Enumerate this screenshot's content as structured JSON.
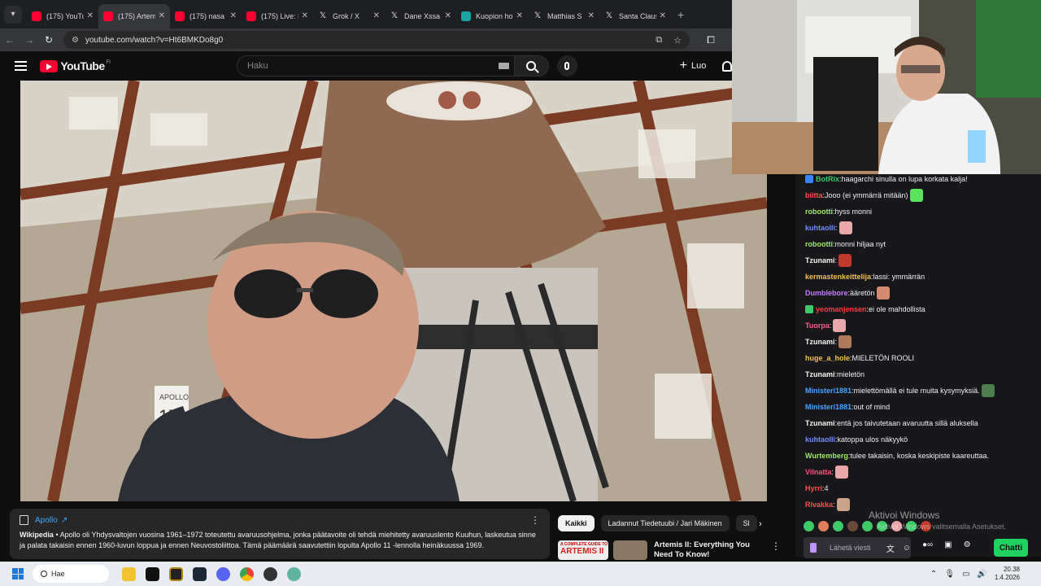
{
  "browser": {
    "tabs": [
      {
        "title": "(175) YouTu",
        "icon": "youtube-icon",
        "active": false
      },
      {
        "title": "(175) Artem",
        "icon": "youtube-icon",
        "active": true
      },
      {
        "title": "(175) nasa l",
        "icon": "youtube-icon",
        "active": false
      },
      {
        "title": "(175) Live: I",
        "icon": "youtube-icon",
        "active": false
      },
      {
        "title": "Grok / X",
        "icon": "x-icon",
        "active": false
      },
      {
        "title": "Dane Xssa",
        "icon": "x-icon",
        "active": false
      },
      {
        "title": "Kuopion ho",
        "icon": "kuopio-icon",
        "active": false
      },
      {
        "title": "Matthias S",
        "icon": "x-icon",
        "active": false
      },
      {
        "title": "Santa Claus",
        "icon": "x-icon",
        "active": false
      }
    ],
    "url": "youtube.com/watch?v=Ht6BMKDo8g0"
  },
  "youtube": {
    "logo_text": "YouTube",
    "region": "FI",
    "search_placeholder": "Haku",
    "create_label": "Luo"
  },
  "wiki_panel": {
    "title": "Apollo",
    "source": "Wikipedia",
    "text": "Apollo oli Yhdysvaltojen vuosina 1961–1972 toteutettu avaruusohjelma, jonka päätavoite oli tehdä miehitetty avaruuslento Kuuhun, laskeutua sinne ja palata takaisin ennen 1960-luvun loppua ja ennen Neuvostoliittoa. Tämä päämäärä saavutettiin lopulta Apollo 11 -lennolla heinäkuussa 1969."
  },
  "chips": [
    "Kaikki",
    "Ladannut Tiedetuubi / Jari Mäkinen",
    "Sl"
  ],
  "related": {
    "thumb_small": "A COMPLETE GUIDE TO",
    "thumb_big": "ARTEMIS II",
    "title": "Artemis II: Everything You Need To Know!"
  },
  "video": {
    "sign_text": "APOLLO",
    "sign_number": "17"
  },
  "chat": {
    "messages": [
      {
        "user": "BotRix",
        "color": "#3ec96a",
        "text": "haagarchi sinulla on lupa korkata kalja!",
        "badge": "#3b82f6"
      },
      {
        "user": "biitta",
        "color": "#ff4f4f",
        "text": "Jooo (ei ymmärrä mitään)",
        "emote": "#5be35b"
      },
      {
        "user": "robootti",
        "color": "#9ee86c",
        "text": "hyss monni"
      },
      {
        "user": "kuhtaolli",
        "color": "#6f8cff",
        "text": "",
        "emote": "#e9a8a8"
      },
      {
        "user": "robootti",
        "color": "#9ee86c",
        "text": "monni hiljaa nyt"
      },
      {
        "user": "Tzunami",
        "color": "#f1f1f1",
        "text": "",
        "emote": "#c0392b"
      },
      {
        "user": "kermastenkeittelija",
        "color": "#f2c14e",
        "text": "lassi: ymmärrän"
      },
      {
        "user": "Dumblebore",
        "color": "#c77dff",
        "text": "ääretön",
        "emote": "#d68a6f"
      },
      {
        "user": "yeomanjensen",
        "color": "#ff3b3b",
        "text": "ei ole mahdollista",
        "badge": "#3ec96a"
      },
      {
        "user": "Tuorpa",
        "color": "#ff5a8a",
        "text": "",
        "emote": "#e9a8a8"
      },
      {
        "user": "Tzunami",
        "color": "#f1f1f1",
        "text": "",
        "emote": "#b07a5a"
      },
      {
        "user": "huge_a_hole",
        "color": "#f2c14e",
        "text": "MIELETÖN ROOLI"
      },
      {
        "user": "Tzunami",
        "color": "#f1f1f1",
        "text": "mieletön"
      },
      {
        "user": "Ministeri1881",
        "color": "#4aa3ff",
        "text": "mielettömällä ei tule muita kysymyksiä.",
        "emote": "#4f7d4f"
      },
      {
        "user": "Ministeri1881",
        "color": "#4aa3ff",
        "text": "out of mind"
      },
      {
        "user": "Tzunami",
        "color": "#f1f1f1",
        "text": "entä jos taivutetaan avaruutta sillä aluksella"
      },
      {
        "user": "kuhtaolli",
        "color": "#6f8cff",
        "text": "katoppa ulos näkyykö"
      },
      {
        "user": "Wurtemberg",
        "color": "#9ee86c",
        "text": "tulee takaisin, koska keskipiste kaareuttaa."
      },
      {
        "user": "Vilnatta",
        "color": "#ff4f7b",
        "text": "",
        "emote": "#e9a8a8"
      },
      {
        "user": "Hyrri",
        "color": "#ff4f4f",
        "text": "4"
      },
      {
        "user": "Rivakka",
        "color": "#ff4f4f",
        "text": "",
        "emote": "#c9a48a"
      }
    ],
    "input_placeholder": "Lähetä viesti",
    "send_label": "Chatti"
  },
  "watermark": {
    "line1": "Aktivoi Windows",
    "line2": "Aktivoi Windows valitsemalla Asetukset."
  },
  "taskbar": {
    "search_label": "Hae",
    "time": "20.38",
    "date": "1.4.2026"
  }
}
